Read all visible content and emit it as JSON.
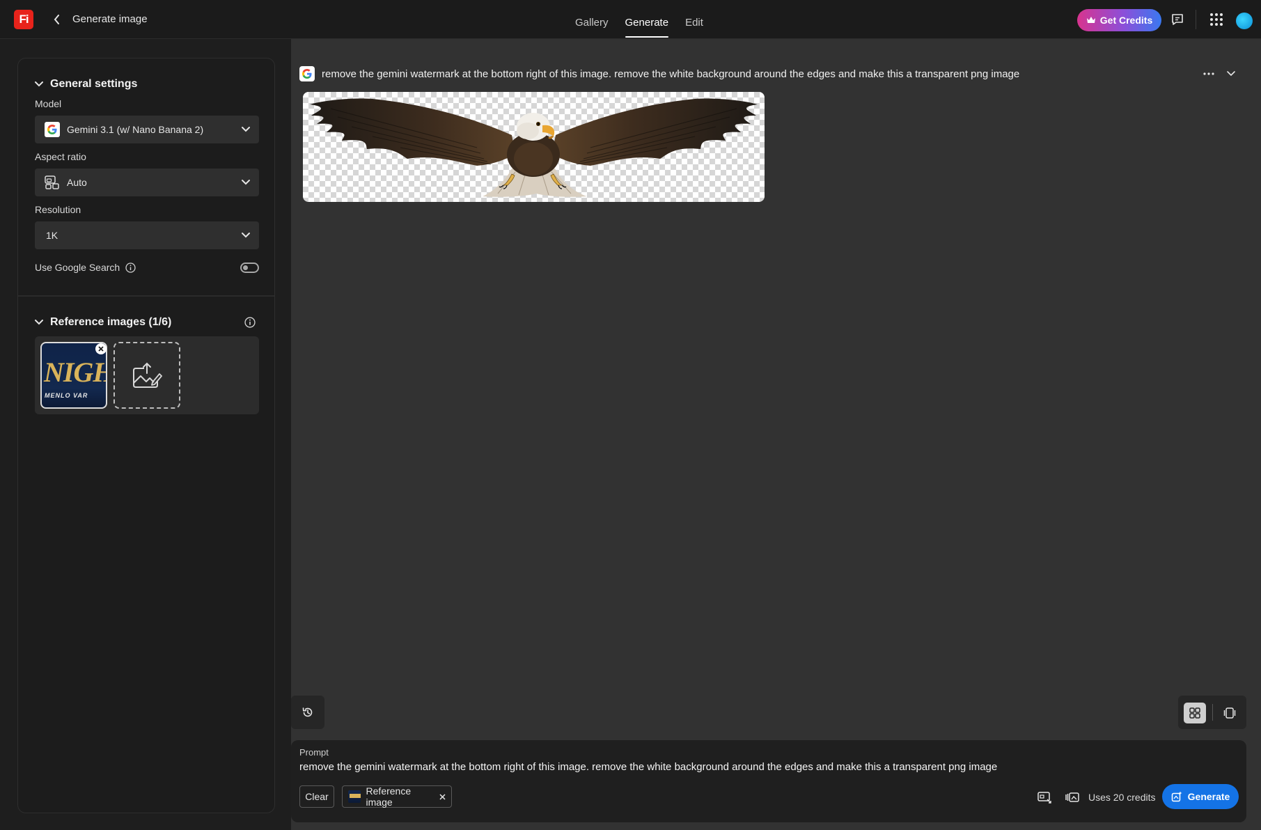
{
  "app": {
    "logo_text": "Fi",
    "brand_color": "#e8231b",
    "page_title": "Generate image"
  },
  "nav": {
    "tabs": [
      {
        "label": "Gallery",
        "active": false
      },
      {
        "label": "Generate",
        "active": true
      },
      {
        "label": "Edit",
        "active": false
      }
    ],
    "credits_button": "Get Credits"
  },
  "settings": {
    "general_title": "General settings",
    "model": {
      "label": "Model",
      "value": "Gemini 3.1 (w/ Nano Banana 2)",
      "icon": "google-g-icon"
    },
    "aspect_ratio": {
      "label": "Aspect ratio",
      "value": "Auto",
      "icon": "aspect-ratio-icon"
    },
    "resolution": {
      "label": "Resolution",
      "value": "1K"
    },
    "google_search": {
      "label": "Use Google Search",
      "enabled": false
    }
  },
  "reference": {
    "title": "Reference images (1/6)",
    "thumb_text_main": "NIGH",
    "thumb_text_sub": "MENLO VAR"
  },
  "result": {
    "prompt": "remove the gemini watermark at the bottom right of this image. remove the white background around the edges and make this a transparent png image",
    "image_subject": "bald-eagle-transparent"
  },
  "prompt_bar": {
    "label": "Prompt",
    "value": "remove the gemini watermark at the bottom right of this image. remove the white background around the edges and make this a transparent png image",
    "clear_label": "Clear",
    "chip_label": "Reference image",
    "credits_text": "Uses 20 credits",
    "generate_label": "Generate",
    "generate_color": "#1473e6"
  }
}
